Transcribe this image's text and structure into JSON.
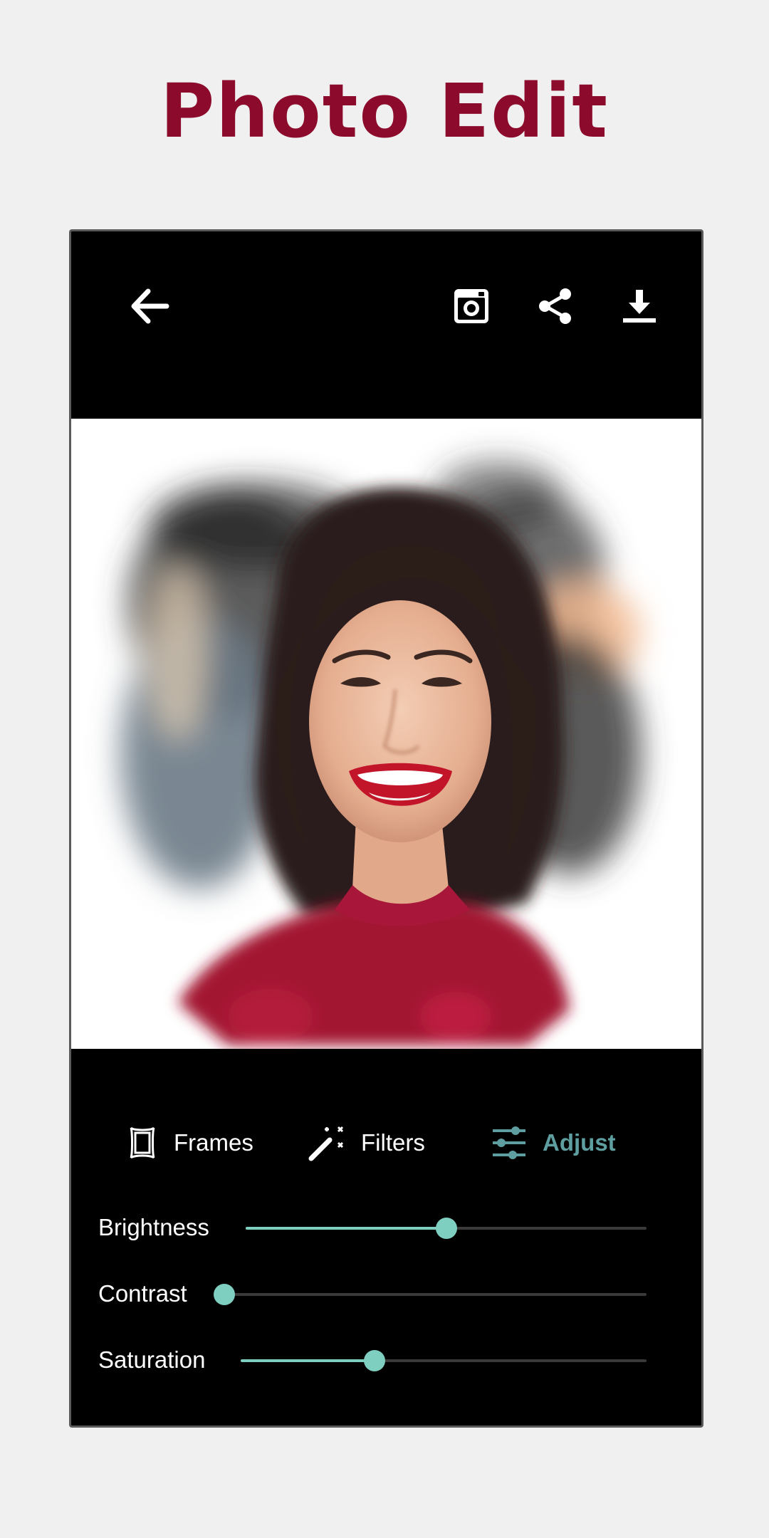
{
  "headline": "Photo Edit",
  "colors": {
    "headline": "#8c0a2b",
    "accent": "#7ecfc0",
    "adjust_active": "#5e9ea0",
    "track": "#3a3a3a",
    "toolbar_icon": "#ffffff"
  },
  "toolbar": {
    "icons": [
      "back-arrow-icon",
      "instagram-icon",
      "share-icon",
      "download-icon"
    ]
  },
  "tabs": [
    {
      "label": "Frames",
      "icon": "frame-icon",
      "active": false
    },
    {
      "label": "Filters",
      "icon": "magic-wand-icon",
      "active": false
    },
    {
      "label": "Adjust",
      "icon": "sliders-icon",
      "active": true
    }
  ],
  "sliders": [
    {
      "label": "Brightness",
      "value": 0.5
    },
    {
      "label": "Contrast",
      "value": 0.0
    },
    {
      "label": "Saturation",
      "value": 0.33
    }
  ]
}
